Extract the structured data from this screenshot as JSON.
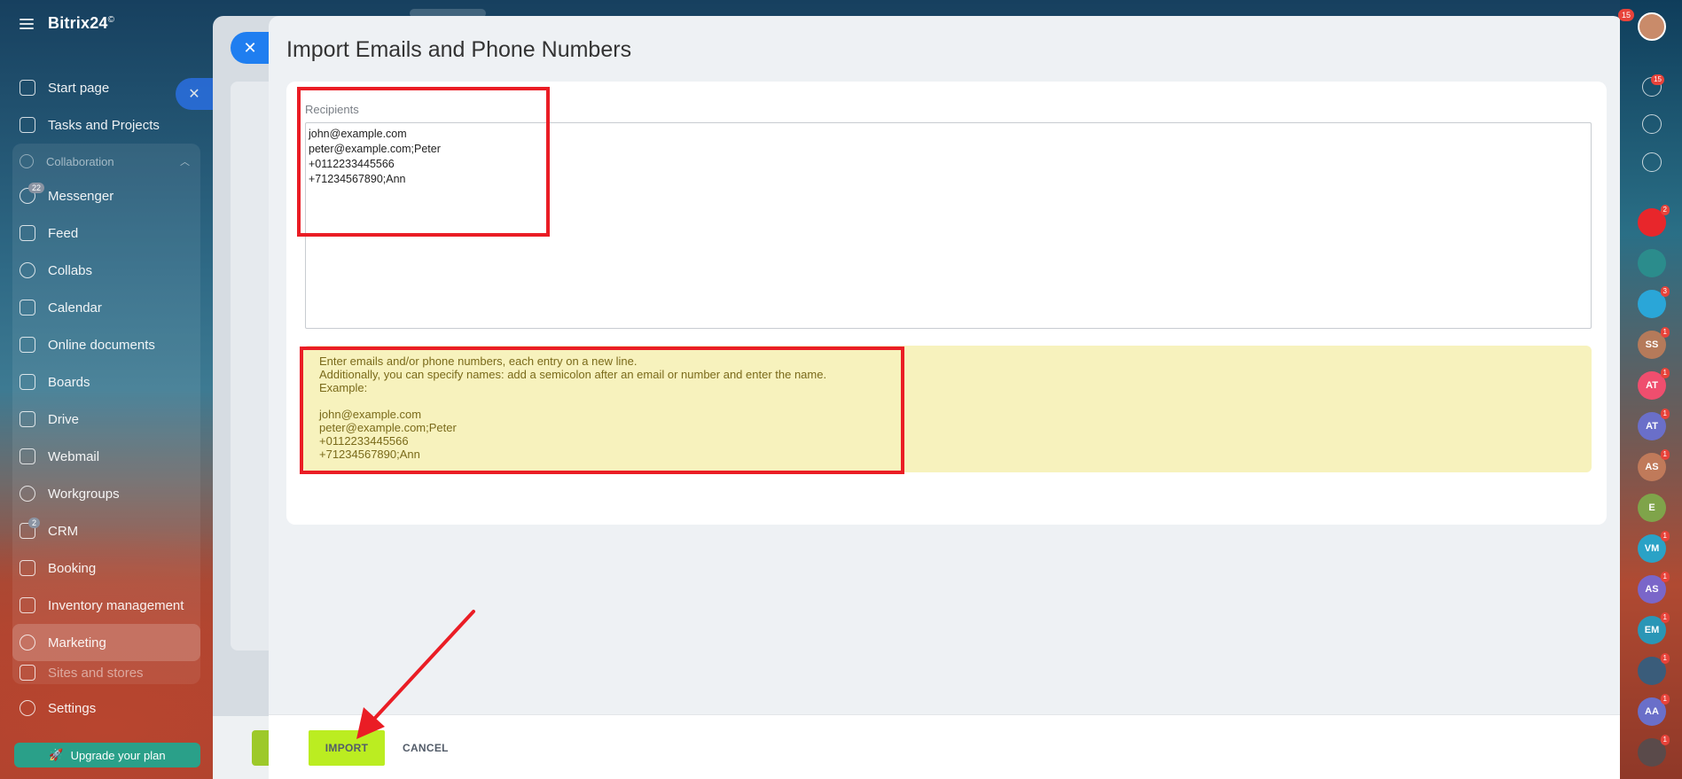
{
  "app": {
    "logo": "Bitrix24",
    "logo_mark": "©"
  },
  "sidebar": {
    "items_top": [
      {
        "label": "Start page",
        "icon": "home-icon"
      },
      {
        "label": "Tasks and Projects",
        "icon": "checkbox-icon"
      }
    ],
    "group": {
      "label": "Collaboration",
      "items": [
        {
          "label": "Messenger",
          "icon": "chat-icon",
          "badge": "22"
        },
        {
          "label": "Feed",
          "icon": "feed-icon"
        },
        {
          "label": "Collabs",
          "icon": "collabs-icon"
        },
        {
          "label": "Calendar",
          "icon": "calendar-icon"
        },
        {
          "label": "Online documents",
          "icon": "document-icon"
        },
        {
          "label": "Boards",
          "icon": "board-icon"
        },
        {
          "label": "Drive",
          "icon": "drive-icon"
        },
        {
          "label": "Webmail",
          "icon": "mail-icon"
        },
        {
          "label": "Workgroups",
          "icon": "workgroups-icon"
        },
        {
          "label": "CRM",
          "icon": "crm-icon",
          "badge": "2"
        },
        {
          "label": "Booking",
          "icon": "booking-icon"
        },
        {
          "label": "Inventory management",
          "icon": "inventory-icon"
        },
        {
          "label": "Marketing",
          "icon": "marketing-icon",
          "active": true
        },
        {
          "label": "Sites and stores",
          "icon": "sites-icon"
        }
      ]
    },
    "settings": "Settings",
    "upgrade": "Upgrade your plan"
  },
  "dialog": {
    "title": "Import Emails and Phone Numbers",
    "recipients_label": "Recipients",
    "recipients_value": "john@example.com\npeter@example.com;Peter\n+0112233445566\n+71234567890;Ann",
    "hint_lines": [
      "Enter emails and/or phone numbers, each entry on a new line.",
      "Additionally, you can specify names: add a semicolon after an email or number and enter the name.",
      "Example:"
    ],
    "hint_examples": [
      "john@example.com",
      "peter@example.com;Peter",
      "+0112233445566",
      "+71234567890;Ann"
    ],
    "import_label": "IMPORT",
    "cancel_label": "CANCEL"
  },
  "rightbar": {
    "top_count": "15",
    "notifications_count": "15",
    "avatars": [
      {
        "initials": "",
        "color": "#e8262b",
        "count": "2"
      },
      {
        "initials": "",
        "color": "#2b8c8c",
        "count": ""
      },
      {
        "initials": "",
        "color": "#2aa6d8",
        "count": "3"
      },
      {
        "initials": "SS",
        "color": "#b57a5a",
        "count": "1"
      },
      {
        "initials": "AT",
        "color": "#ef4e6e",
        "count": "1"
      },
      {
        "initials": "AT",
        "color": "#6a6fc9",
        "count": "1"
      },
      {
        "initials": "AS",
        "color": "#c07a5a",
        "count": "1"
      },
      {
        "initials": "E",
        "color": "#7fa44a",
        "count": ""
      },
      {
        "initials": "VM",
        "color": "#2aa2c6",
        "count": "1"
      },
      {
        "initials": "AS",
        "color": "#7a66c9",
        "count": "1"
      },
      {
        "initials": "EM",
        "color": "#2a96b6",
        "count": "1"
      },
      {
        "initials": "",
        "color": "#3a5c7a",
        "count": "1"
      },
      {
        "initials": "AA",
        "color": "#6a6fc9",
        "count": "1"
      },
      {
        "initials": "",
        "color": "#5a4a4a",
        "count": "1"
      }
    ]
  },
  "colors": {
    "accent": "#1f7ef0",
    "import_button": "#bbed21",
    "highlight": "#ea1d25",
    "hint_bg": "#f7f2bd"
  }
}
